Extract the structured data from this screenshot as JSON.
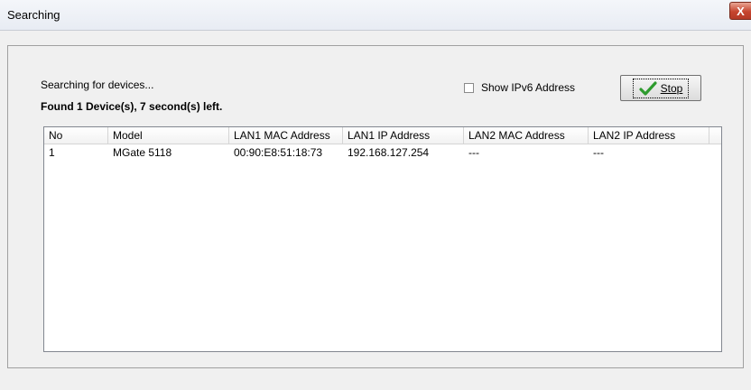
{
  "window": {
    "title": "Searching",
    "close_label": "X"
  },
  "status": {
    "searching": "Searching for devices...",
    "found": "Found 1 Device(s), 7 second(s) left."
  },
  "options": {
    "show_ipv6_label": "Show IPv6 Address",
    "show_ipv6_checked": false
  },
  "stop_button": {
    "label": "Stop",
    "icon": "check-icon"
  },
  "table": {
    "headers": [
      "No",
      "Model",
      "LAN1 MAC Address",
      "LAN1 IP Address",
      "LAN2 MAC Address",
      "LAN2 IP Address"
    ],
    "rows": [
      [
        "1",
        "MGate 5118",
        "00:90:E8:51:18:73",
        "192.168.127.254",
        "---",
        "---"
      ]
    ]
  },
  "colors": {
    "check_green": "#2e9b2e",
    "close_red": "#c6452f"
  }
}
